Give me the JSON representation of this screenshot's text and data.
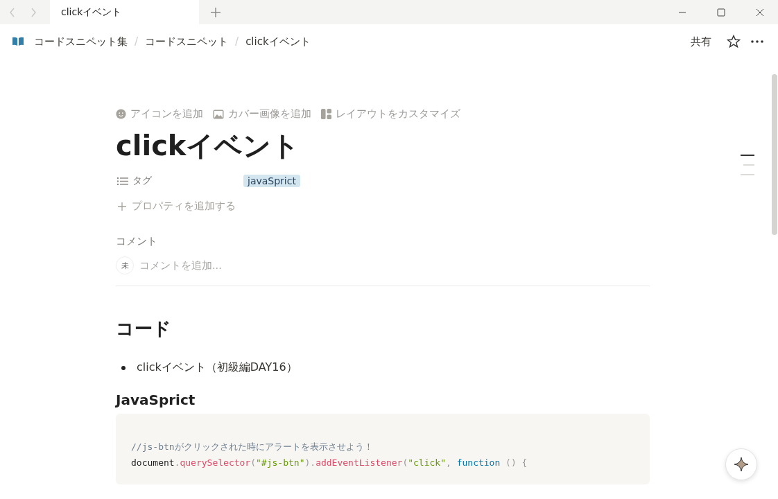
{
  "tabs": [
    {
      "title": "clickイベント",
      "selected": true
    }
  ],
  "breadcrumb": [
    "コードスニペット集",
    "コードスニペット",
    "clickイベント"
  ],
  "breadcrumb_separators": [
    "/",
    "/"
  ],
  "topbar": {
    "share": "共有"
  },
  "page_actions": [
    {
      "kind": "icon",
      "label": "アイコンを追加"
    },
    {
      "kind": "cover",
      "label": "カバー画像を追加"
    },
    {
      "kind": "layout",
      "label": "レイアウトをカスタマイズ"
    }
  ],
  "title": "clickイベント",
  "properties": [
    {
      "name": "タグ",
      "tags": [
        {
          "label": "javaSprict",
          "color": "#d3e5ef"
        }
      ]
    }
  ],
  "add_property": "プロパティを追加する",
  "comments": {
    "heading": "コメント",
    "avatar": "未",
    "placeholder": "コメントを追加..."
  },
  "heading": "コード",
  "bullets": [
    "clickイベント（初級編DAY16）"
  ],
  "subheading": "JavaSprict",
  "code": [
    [
      {
        "kind": "comment",
        "text": "//js-btnがクリックされた時にアラートを表示させよう！"
      }
    ],
    [
      {
        "kind": "plain",
        "text": "document"
      },
      {
        "kind": "punct",
        "text": "."
      },
      {
        "kind": "method",
        "text": "querySelector"
      },
      {
        "kind": "punct",
        "text": "("
      },
      {
        "kind": "string",
        "text": "\"#js-btn\""
      },
      {
        "kind": "punct",
        "text": ")."
      },
      {
        "kind": "method",
        "text": "addEventListener"
      },
      {
        "kind": "punct",
        "text": "("
      },
      {
        "kind": "string",
        "text": "\"click\""
      },
      {
        "kind": "punct",
        "text": ", "
      },
      {
        "kind": "keyword",
        "text": "function"
      },
      {
        "kind": "punct",
        "text": " () {"
      }
    ]
  ],
  "outline": [
    {
      "selected": true
    },
    {
      "selected": false
    },
    {
      "selected": false
    }
  ]
}
